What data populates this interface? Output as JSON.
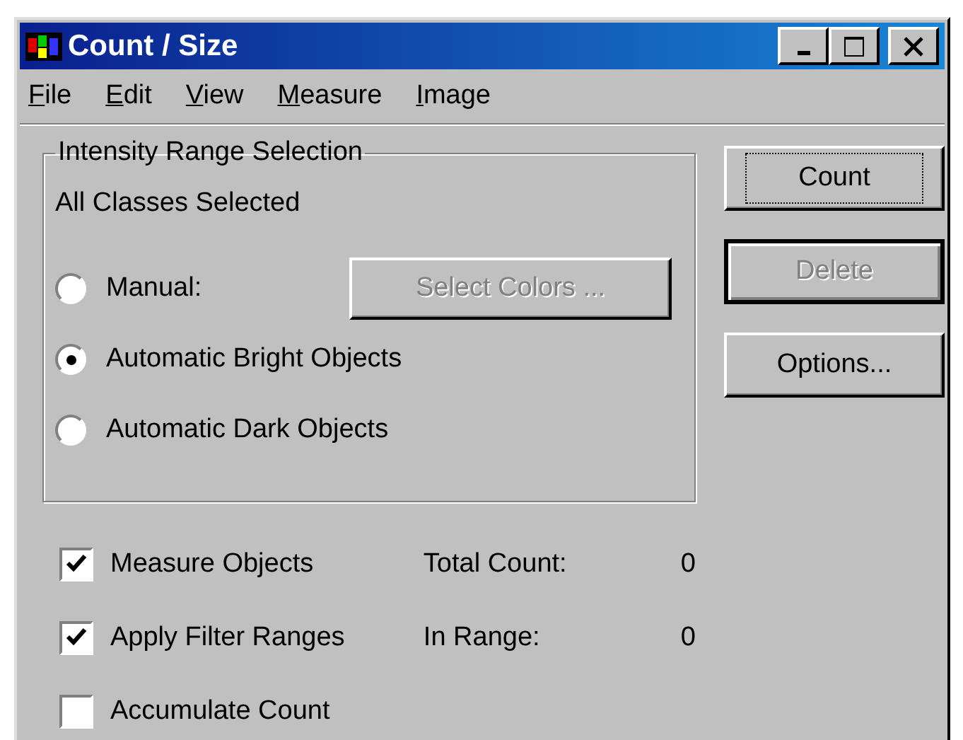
{
  "window": {
    "title": "Count / Size"
  },
  "menu": [
    "File",
    "Edit",
    "View",
    "Measure",
    "Image"
  ],
  "group": {
    "title": "Intensity Range Selection",
    "status": "All Classes Selected",
    "select_button": {
      "label": "Select Colors ...",
      "disabled": true
    },
    "radios": [
      {
        "label": "Manual:",
        "selected": false
      },
      {
        "label": "Automatic Bright Objects",
        "selected": true
      },
      {
        "label": "Automatic Dark Objects",
        "selected": false
      }
    ]
  },
  "buttons": [
    {
      "label": "Count",
      "disabled": false,
      "focused": true,
      "default": false
    },
    {
      "label": "Delete",
      "disabled": true,
      "focused": false,
      "default": true
    },
    {
      "label": "Options...",
      "disabled": false,
      "focused": false,
      "default": false
    }
  ],
  "checkboxes": [
    {
      "label": "Measure Objects",
      "checked": true
    },
    {
      "label": "Apply Filter Ranges",
      "checked": true
    },
    {
      "label": "Accumulate Count",
      "checked": false
    }
  ],
  "stats": [
    {
      "label": "Total Count:",
      "value": "0"
    },
    {
      "label": "In Range:",
      "value": "0"
    }
  ]
}
